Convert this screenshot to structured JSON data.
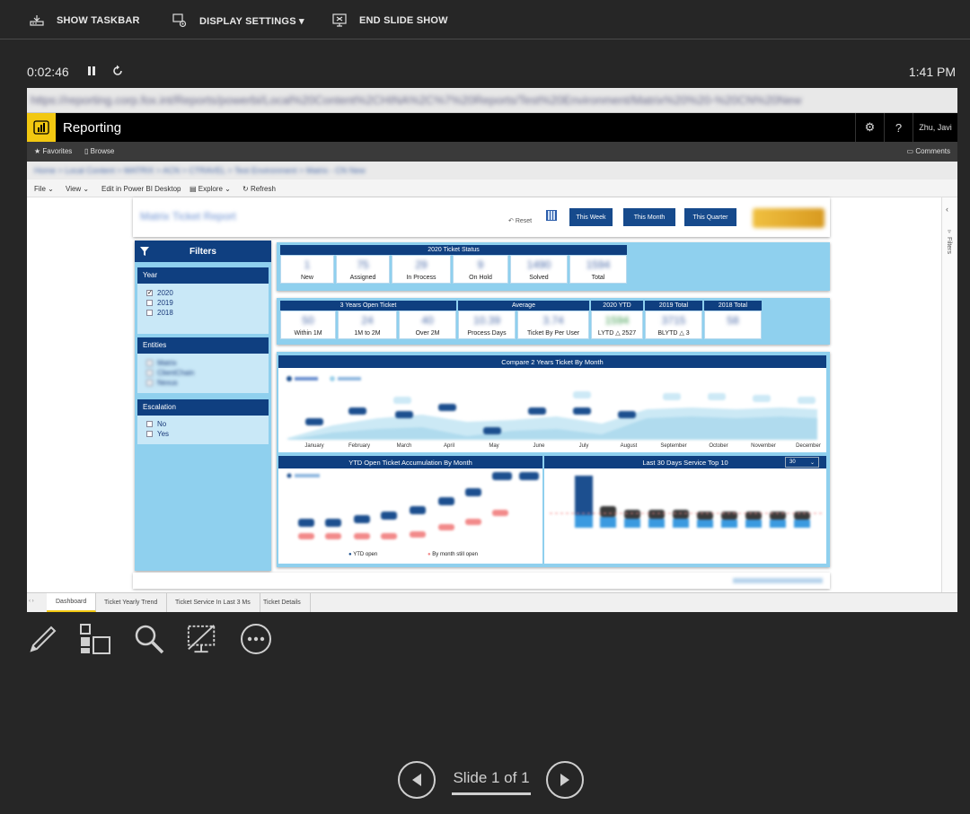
{
  "toolbar": {
    "show_taskbar": "SHOW TASKBAR",
    "display_settings": "DISPLAY SETTINGS ▾",
    "end_slide_show": "END SLIDE SHOW"
  },
  "presenter": {
    "elapsed": "0:02:46",
    "clock": "1:41 PM",
    "slide_counter": "Slide 1 of 1"
  },
  "browser": {
    "url": "https://reporting.corp.fox.int/Reports/powerbi/Local%20Content%2CHINA%2C%7%20Reports/Test%20Environment/Matrix%20%20-%20CN%20New"
  },
  "pbi": {
    "app_title": "Reporting",
    "user": "Zhu, Javi",
    "favorites": "Favorites",
    "browse": "Browse",
    "comments": "Comments",
    "breadcrumb": "Home  >  Local Content  >  MATRIX  >  ACN  >  CTRAVEL  >  Test Environment  >  Matrix - CN New",
    "menu": {
      "file": "File ⌄",
      "view": "View ⌄",
      "edit": "Edit in Power BI Desktop",
      "explore": "Explore ⌄",
      "refresh": "Refresh"
    },
    "filters_pane_label": "Filters"
  },
  "report": {
    "title": "Matrix Ticket Report",
    "reset": "Reset",
    "buttons": [
      "This Week",
      "This Month",
      "This Quarter"
    ],
    "filters": {
      "header": "Filters",
      "year": {
        "title": "Year",
        "options": [
          {
            "label": "2020",
            "checked": true
          },
          {
            "label": "2019",
            "checked": false
          },
          {
            "label": "2018",
            "checked": false
          }
        ]
      },
      "entities": {
        "title": "Entities",
        "options": [
          "Matrix",
          "ClientChain",
          "Nexus"
        ]
      },
      "escalation": {
        "title": "Escalation",
        "options": [
          "No",
          "Yes"
        ]
      }
    },
    "status": {
      "title": "2020 Ticket Status",
      "cards": [
        {
          "value": "1",
          "label": "New"
        },
        {
          "value": "75",
          "label": "Assigned"
        },
        {
          "value": "29",
          "label": "In Process"
        },
        {
          "value": "9",
          "label": "On Hold"
        },
        {
          "value": "1490",
          "label": "Solved"
        },
        {
          "value": "1594",
          "label": "Total"
        }
      ]
    },
    "open": {
      "title": "3 Years Open Ticket",
      "cards": [
        {
          "value": "50",
          "label": "Within 1M"
        },
        {
          "value": "24",
          "label": "1M to 2M"
        },
        {
          "value": "40",
          "label": "Over 2M"
        }
      ]
    },
    "average": {
      "title": "Average",
      "cards": [
        {
          "value": "10.39",
          "label": "Process Days"
        },
        {
          "value": "3.74",
          "label": "Ticket By Per User"
        }
      ]
    },
    "ytd": {
      "title": "2020 YTD",
      "value": "1594",
      "label": "LYTD △ 2527"
    },
    "total_2019": {
      "title": "2019 Total",
      "value": "3715",
      "label": "BLYTD △ 3"
    },
    "total_2018": {
      "title": "2018 Total",
      "value": "58",
      "label": ""
    },
    "compare_chart": {
      "title": "Compare 2 Years Ticket By Month",
      "months": [
        "January",
        "February",
        "March",
        "April",
        "May",
        "June",
        "July",
        "August",
        "September",
        "October",
        "November",
        "December"
      ]
    },
    "ytd_chart": {
      "title": "YTD Open Ticket Accumulation By Month",
      "legend": [
        "YTD open",
        "By month still open"
      ]
    },
    "top10_chart": {
      "title": "Last 30 Days Service Top 10",
      "dropdown": "30"
    }
  },
  "page_tabs": [
    "Dashboard",
    "Ticket Yearly Trend",
    "Ticket Service In Last 3 Ms",
    "Ticket Details"
  ],
  "colors": {
    "background": "#262626",
    "pbi_yellow": "#f2c811",
    "navy": "#0f3f80",
    "panel_blue": "#8fd0ee"
  },
  "tools": [
    "pen-icon",
    "slide-sorter-icon",
    "zoom-icon",
    "black-screen-icon",
    "more-options-icon"
  ]
}
